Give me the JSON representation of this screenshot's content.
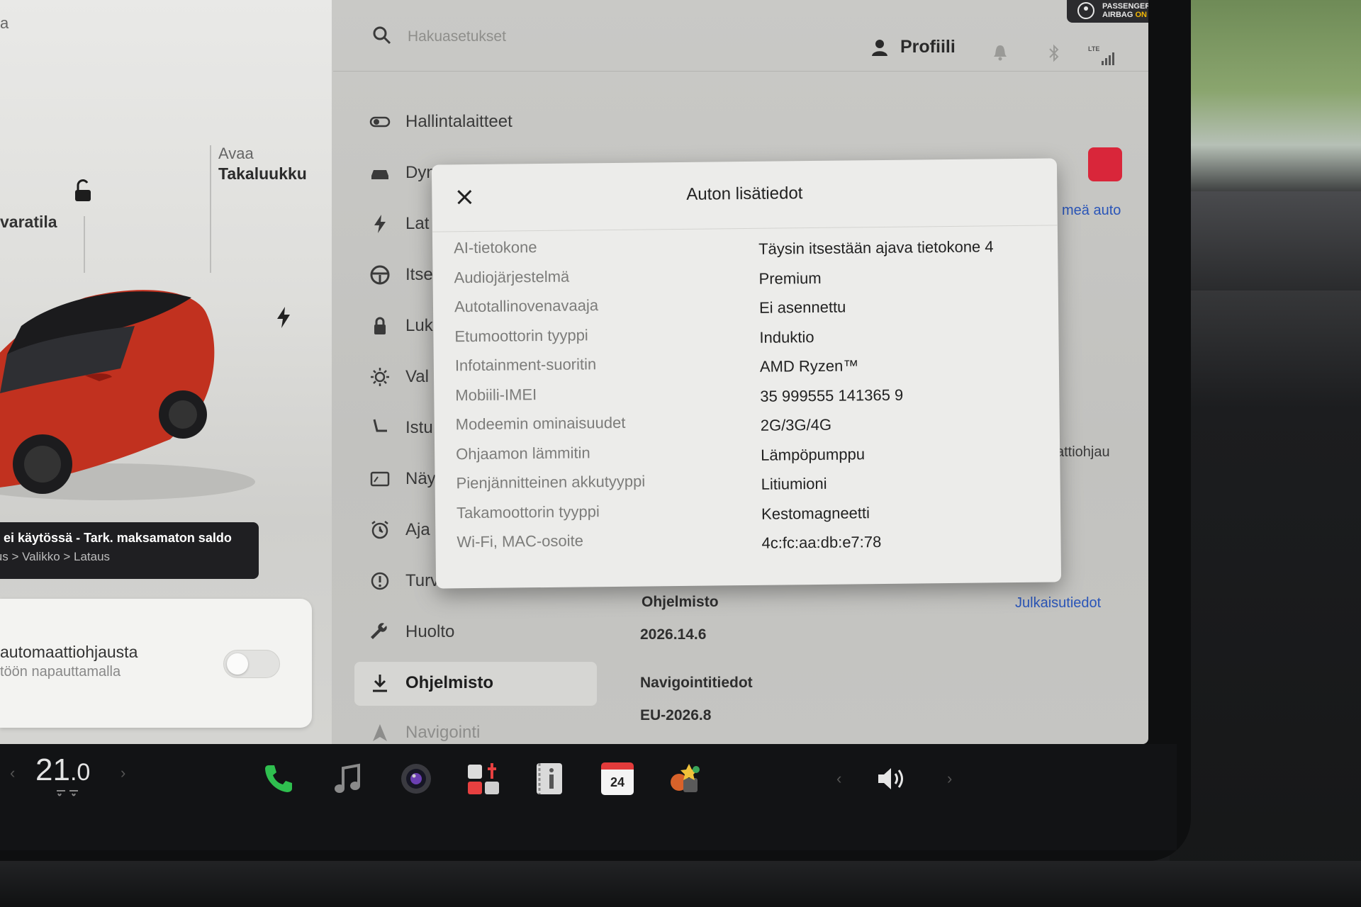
{
  "car_panel": {
    "trunk_label_top": "Avaa",
    "trunk_label": "Takaluukku",
    "left_label": "varatila",
    "alert_title": "s ei käytössä - Tark. maksamaton saldo",
    "alert_sub": "lus > Valikko > Lataus",
    "auto_title": "automaattiohjausta",
    "auto_sub": "töön napauttamalla"
  },
  "header": {
    "search_placeholder": "Hakuasetukset",
    "profile_label": "Profiili",
    "airbag_line1": "PASSENGER",
    "airbag_line2": "AIRBAG",
    "airbag_on": "ON",
    "lte_label": "LTE"
  },
  "menu": {
    "items": [
      {
        "label": "Hallintalaitteet",
        "icon": "toggle-icon"
      },
      {
        "label": "Dyn",
        "icon": "car-icon"
      },
      {
        "label": "Lat",
        "icon": "bolt-icon"
      },
      {
        "label": "Itse",
        "icon": "steering-wheel-icon"
      },
      {
        "label": "Luk",
        "icon": "lock-icon"
      },
      {
        "label": "Val",
        "icon": "sun-icon"
      },
      {
        "label": "Istu",
        "icon": "seat-icon"
      },
      {
        "label": "Näy",
        "icon": "display-icon"
      },
      {
        "label": "Aja",
        "icon": "clock-icon"
      },
      {
        "label": "Turvallisuus",
        "icon": "alert-circle-icon"
      },
      {
        "label": "Huolto",
        "icon": "wrench-icon"
      },
      {
        "label": "Ohjelmisto",
        "icon": "download-icon"
      },
      {
        "label": "Navigointi",
        "icon": "navigation-icon"
      }
    ]
  },
  "content": {
    "link_auto": "meä auto",
    "text_autopilot": "attiohjau",
    "software_label": "Ohjelmisto",
    "software_version": "2026.14.6",
    "release_notes": "Julkaisutiedot",
    "nav_label": "Navigointitiedot",
    "nav_version": "EU-2026.8"
  },
  "modal": {
    "title": "Auton lisätiedot",
    "rows": [
      {
        "label": "AI-tietokone",
        "value": "Täysin itsestään ajava tietokone 4"
      },
      {
        "label": "Audiojärjestelmä",
        "value": "Premium"
      },
      {
        "label": "Autotallinovenavaaja",
        "value": "Ei asennettu"
      },
      {
        "label": "Etumoottorin tyyppi",
        "value": "Induktio"
      },
      {
        "label": "Infotainment-suoritin",
        "value": "AMD Ryzen™"
      },
      {
        "label": "Mobiili-IMEI",
        "value": "35 999555 141365 9"
      },
      {
        "label": "Modeemin ominaisuudet",
        "value": "2G/3G/4G"
      },
      {
        "label": "Ohjaamon lämmitin",
        "value": "Lämpöpumppu"
      },
      {
        "label": "Pienjännitteinen akkutyyppi",
        "value": "Litiumioni"
      },
      {
        "label": "Takamoottorin tyyppi",
        "value": "Kestomagneetti"
      },
      {
        "label": "Wi-Fi, MAC-osoite",
        "value": "4c:fc:aa:db:e7:78"
      }
    ]
  },
  "taskbar": {
    "temperature_int": "21",
    "temperature_dec": ".0",
    "calendar_day": "24"
  },
  "colors": {
    "accent_link": "#2a55b8",
    "phone_green": "#2fbf4f",
    "red_badge": "#d9263a"
  }
}
